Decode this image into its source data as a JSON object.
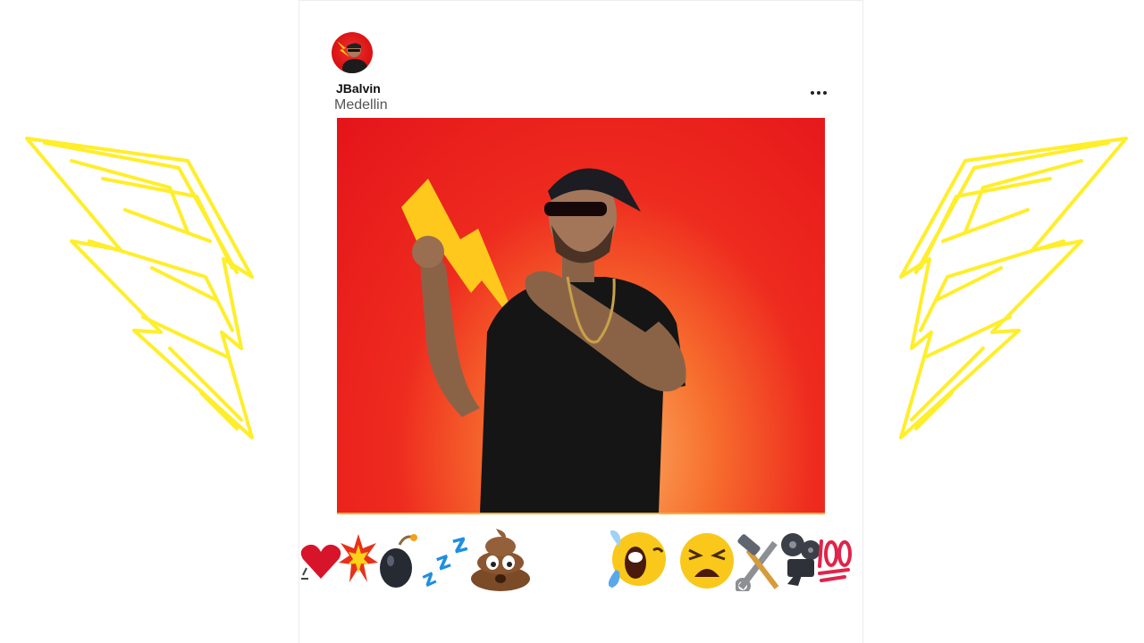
{
  "post": {
    "username": "JBalvin",
    "location": "Medellin"
  },
  "menu": {
    "more_icon": "more-horizontal-icon"
  },
  "colors": {
    "bolt_yellow": "#ffee2a",
    "photo_red": "#e4141a",
    "photo_glow": "#fbb36a",
    "shirt_black": "#151515"
  },
  "emoji_strip": [
    "red-heart-icon",
    "collision-icon",
    "bomb-icon",
    "zzz-icon",
    "pile-of-poo-icon",
    "face-with-tears-of-joy-icon",
    "tired-face-icon",
    "hammer-and-wrench-icon",
    "film-projector-icon",
    "hundred-points-icon"
  ]
}
